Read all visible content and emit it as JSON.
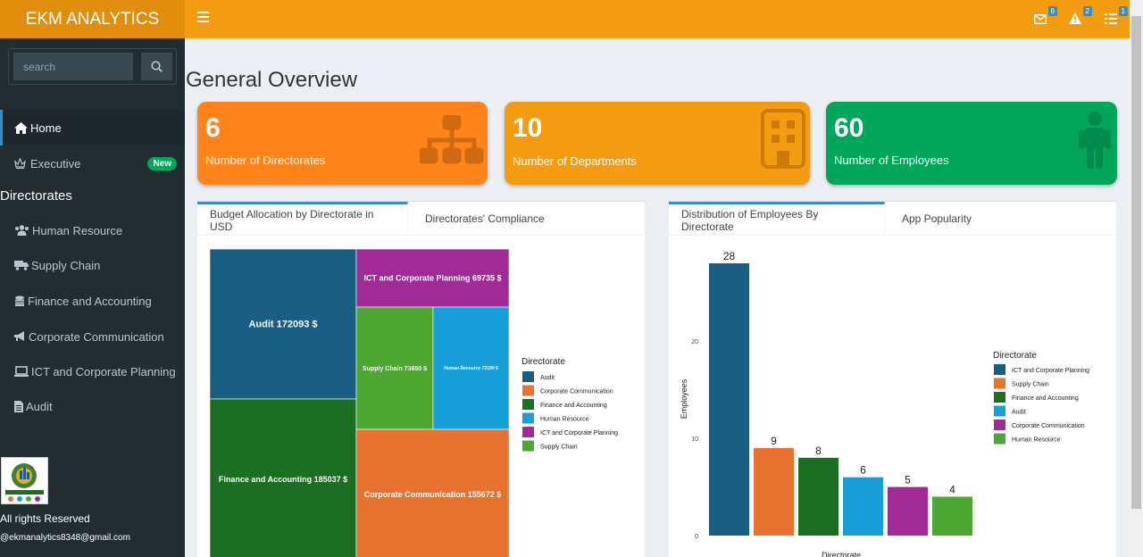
{
  "app": {
    "title": "EKM ANALYTICS"
  },
  "header": {
    "icons": [
      {
        "name": "envelope-icon",
        "count": "6"
      },
      {
        "name": "warning-icon",
        "count": "2"
      },
      {
        "name": "tasks-icon",
        "count": "1"
      }
    ]
  },
  "search": {
    "placeholder": "search"
  },
  "sidebar": {
    "items": [
      {
        "label": "Home",
        "icon": "home-icon"
      },
      {
        "label": "Executive",
        "icon": "crown-icon",
        "badge": "New"
      }
    ],
    "section_title": "Directorates",
    "directorates": [
      {
        "label": "Human Resource",
        "icon": "users-icon"
      },
      {
        "label": "Supply Chain",
        "icon": "truck-icon"
      },
      {
        "label": "Finance and Accounting",
        "icon": "coins-icon"
      },
      {
        "label": "Corporate Communication",
        "icon": "bullhorn-icon"
      },
      {
        "label": "ICT and Corporate Planning",
        "icon": "laptop-icon"
      },
      {
        "label": "Audit",
        "icon": "file-icon"
      }
    ],
    "footer_rights": "All rights Reserved",
    "footer_email": "@ekmanalytics8348@gmail.com"
  },
  "main": {
    "title": "General Overview",
    "stats": [
      {
        "value": "6",
        "label": "Number of Directorates",
        "color": "#ff851b",
        "icon": "sitemap-icon"
      },
      {
        "value": "10",
        "label": "Number of Departments",
        "color": "#f39c12",
        "icon": "building-icon"
      },
      {
        "value": "60",
        "label": "Number of Employees",
        "color": "#00a65a",
        "icon": "person-icon"
      }
    ],
    "left_panel": {
      "tabs": [
        "Budget Allocation by Directorate in USD",
        "Directorates' Compliance"
      ]
    },
    "right_panel": {
      "tabs": [
        "Distribution of Employees By Directorate",
        "App Popularity"
      ]
    }
  },
  "chart_data": [
    {
      "type": "treemap",
      "legend_title": "Directorate",
      "legend_position": "right",
      "cells": [
        {
          "name": "Audit",
          "value": 172093,
          "label": "Audit 172093 $",
          "color": "#1a5e84"
        },
        {
          "name": "Corporate Communication",
          "value": 155672,
          "label": "Corporate Communication 155672 $",
          "color": "#e8722f"
        },
        {
          "name": "Finance and Accounting",
          "value": 185037,
          "label": "Finance and Accounting 185037 $",
          "color": "#1c6e23"
        },
        {
          "name": "Human Resource",
          "value": 72190,
          "label": "Human Resource 72190 $",
          "color": "#189ed8"
        },
        {
          "name": "ICT and Corporate Planning",
          "value": 69735,
          "label": "ICT and Corporate Planning 69735 $",
          "color": "#a02b96"
        },
        {
          "name": "Supply Chain",
          "value": 73650,
          "label": "Supply Chain 73650 $",
          "color": "#4ea733"
        }
      ]
    },
    {
      "type": "bar",
      "categories": [
        "ICT and Corporate Planning",
        "Supply Chain",
        "Finance and Accounting",
        "Audit",
        "Corporate Communication",
        "Human Resource"
      ],
      "values": [
        28,
        9,
        8,
        6,
        5,
        4
      ],
      "colors": [
        "#1a5e84",
        "#e8722f",
        "#1c6e23",
        "#189ed8",
        "#a02b96",
        "#4ea733"
      ],
      "xlabel": "Directorate",
      "ylabel": "Employees",
      "yticks": [
        0,
        10,
        20
      ],
      "ylim": [
        0,
        28
      ],
      "legend_title": "Directorate",
      "legend_position": "right"
    }
  ]
}
